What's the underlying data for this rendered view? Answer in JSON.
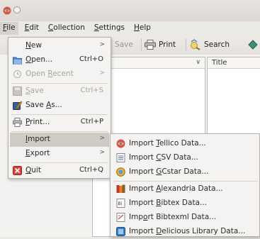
{
  "menubar": {
    "items": [
      {
        "label": "File",
        "underline": "F"
      },
      {
        "label": "Edit",
        "underline": "E"
      },
      {
        "label": "Collection",
        "underline": "C"
      },
      {
        "label": "Settings",
        "underline": "S"
      },
      {
        "label": "Help",
        "underline": "H"
      }
    ]
  },
  "toolbar": {
    "save_label": "Save",
    "print_label": "Print",
    "search_label": "Search"
  },
  "left_panel": {
    "chevron": "∨"
  },
  "right_panel": {
    "column_header": "Title"
  },
  "file_menu": {
    "items": [
      {
        "label": "New",
        "underline": "N",
        "shortcut": "",
        "submenu": true,
        "enabled": true,
        "icon": "none"
      },
      {
        "label": "Open...",
        "underline": "O",
        "shortcut": "Ctrl+O",
        "submenu": false,
        "enabled": true,
        "icon": "folder-open-icon"
      },
      {
        "label": "Open Recent",
        "underline": "R",
        "shortcut": "",
        "submenu": true,
        "enabled": false,
        "icon": "recent-icon"
      },
      {
        "label": "Save",
        "underline": "S",
        "shortcut": "Ctrl+S",
        "submenu": false,
        "enabled": false,
        "icon": "save-icon"
      },
      {
        "label": "Save As...",
        "underline": "A",
        "shortcut": "",
        "submenu": false,
        "enabled": true,
        "icon": "save-as-icon"
      },
      {
        "label": "Print...",
        "underline": "P",
        "shortcut": "Ctrl+P",
        "submenu": false,
        "enabled": true,
        "icon": "printer-icon"
      },
      {
        "label": "Import",
        "underline": "I",
        "shortcut": "",
        "submenu": true,
        "enabled": true,
        "icon": "none",
        "highlighted": true
      },
      {
        "label": "Export",
        "underline": "E",
        "shortcut": "",
        "submenu": true,
        "enabled": true,
        "icon": "none"
      },
      {
        "label": "Quit",
        "underline": "Q",
        "shortcut": "Ctrl+Q",
        "submenu": false,
        "enabled": true,
        "icon": "quit-icon"
      }
    ]
  },
  "import_menu": {
    "items": [
      {
        "label": "Import Tellico Data...",
        "underline": "T",
        "icon": "tellico-icon"
      },
      {
        "label": "Import CSV Data...",
        "underline": "C",
        "icon": "csv-icon"
      },
      {
        "label": "Import GCstar Data...",
        "underline": "G",
        "icon": "gcstar-icon"
      },
      {
        "label": "Import Alexandria Data...",
        "underline": "A",
        "icon": "alexandria-icon"
      },
      {
        "label": "Import Bibtex Data...",
        "underline": "B",
        "icon": "bibtex-icon"
      },
      {
        "label": "Import Bibtexml Data...",
        "underline": "o",
        "icon": "bibtexml-icon"
      },
      {
        "label": "Import Delicious Library Data...",
        "underline": "D",
        "icon": "delicious-icon"
      }
    ]
  },
  "colors": {
    "highlight": "#cfcac3",
    "menu_bg": "#f4f3f1",
    "disabled_text": "#a6a4a0"
  }
}
